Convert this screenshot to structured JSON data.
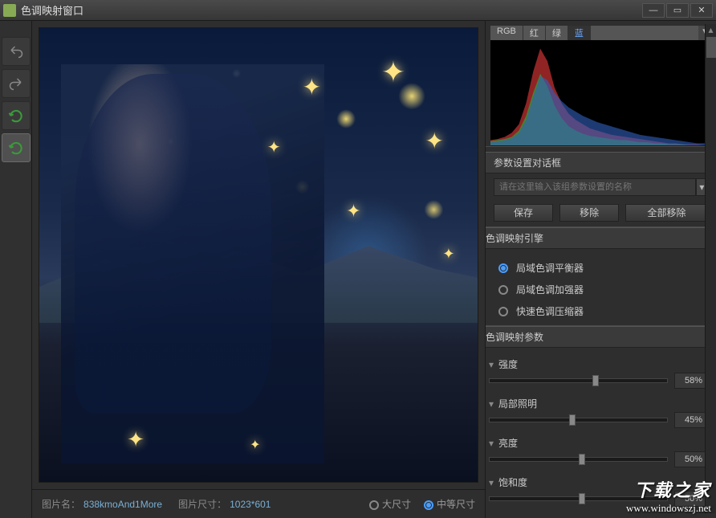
{
  "window": {
    "title": "色调映射窗口"
  },
  "histogram": {
    "tabs": [
      "RGB",
      "红",
      "绿",
      "蓝"
    ],
    "active_tab": "蓝"
  },
  "chart_data": {
    "type": "area",
    "title": "",
    "xlabel": "",
    "ylabel": "",
    "xlim": [
      0,
      255
    ],
    "ylim": [
      0,
      100
    ],
    "series": [
      {
        "name": "红",
        "color": "#c03030",
        "values": [
          5,
          6,
          8,
          12,
          20,
          40,
          70,
          92,
          80,
          55,
          40,
          30,
          24,
          20,
          16,
          14,
          12,
          10,
          9,
          8,
          7,
          6,
          5,
          4,
          3,
          2,
          2,
          1,
          1,
          1,
          0,
          0
        ]
      },
      {
        "name": "绿",
        "color": "#30a030",
        "values": [
          4,
          5,
          6,
          8,
          14,
          28,
          50,
          68,
          56,
          38,
          26,
          18,
          14,
          11,
          9,
          8,
          7,
          6,
          5,
          5,
          4,
          3,
          3,
          2,
          2,
          1,
          1,
          1,
          0,
          0,
          0,
          0
        ]
      },
      {
        "name": "蓝",
        "color": "#3060c0",
        "values": [
          3,
          4,
          5,
          7,
          12,
          24,
          46,
          66,
          62,
          50,
          42,
          36,
          32,
          28,
          25,
          22,
          20,
          18,
          16,
          14,
          12,
          10,
          9,
          8,
          7,
          6,
          5,
          4,
          3,
          2,
          2,
          1
        ]
      }
    ]
  },
  "preset": {
    "header": "参数设置对话框",
    "placeholder": "请在这里输入该组参数设置的名称",
    "save": "保存",
    "remove": "移除",
    "remove_all": "全部移除"
  },
  "engine": {
    "header": "色调映射引擎",
    "options": [
      "局域色调平衡器",
      "局域色调加强器",
      "快速色调压缩器"
    ],
    "selected_index": 0
  },
  "params": {
    "header": "色调映射参数",
    "items": [
      {
        "label": "强度",
        "value": "58%",
        "pos": 58
      },
      {
        "label": "局部照明",
        "value": "45%",
        "pos": 45
      },
      {
        "label": "亮度",
        "value": "50%",
        "pos": 50
      },
      {
        "label": "饱和度",
        "value": "50%",
        "pos": 50
      }
    ]
  },
  "footer": {
    "name_label": "图片名：",
    "name_value": "838kmoAnd1More",
    "size_label": "图片尺寸：",
    "size_value": "1023*601",
    "large": "大尺寸",
    "medium": "中等尺寸",
    "selected": "medium"
  },
  "watermark": {
    "line1": "下载之家",
    "line2": "www.windowszj.net"
  }
}
